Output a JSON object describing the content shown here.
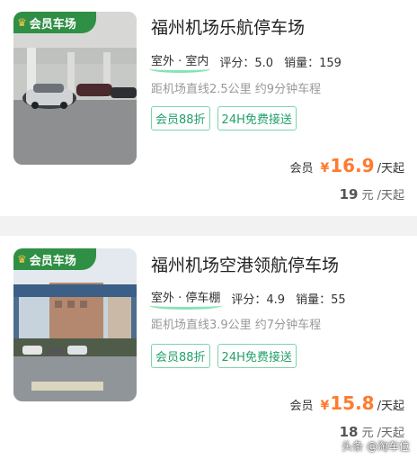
{
  "listings": [
    {
      "badge": "会员车场",
      "title": "福州机场乐航停车场",
      "type": "室外 · 室内",
      "rating": "评分：5.0",
      "sales": "销量：159",
      "distance": "距机场直线2.5公里 约9分钟车程",
      "tags": [
        "会员88折",
        "24H免费接送"
      ],
      "member_label": "会员",
      "currency": "¥",
      "member_price": "16.9",
      "price_unit": "/天起",
      "original_price": "19",
      "original_unit": "元 /天起"
    },
    {
      "badge": "会员车场",
      "title": "福州机场空港领航停车场",
      "type": "室外 · 停车棚",
      "rating": "评分：4.9",
      "sales": "销量：55",
      "distance": "距机场直线3.9公里 约7分钟车程",
      "tags": [
        "会员88折",
        "24H免费接送"
      ],
      "member_label": "会员",
      "currency": "¥",
      "member_price": "15.8",
      "price_unit": "/天起",
      "original_price": "18",
      "original_unit": "元 /天起"
    }
  ],
  "watermark": "头条 @淘车位",
  "colors": {
    "accent": "#ff7a2e",
    "badge_green": "#2f8f45",
    "tag_green": "#22a06b"
  }
}
